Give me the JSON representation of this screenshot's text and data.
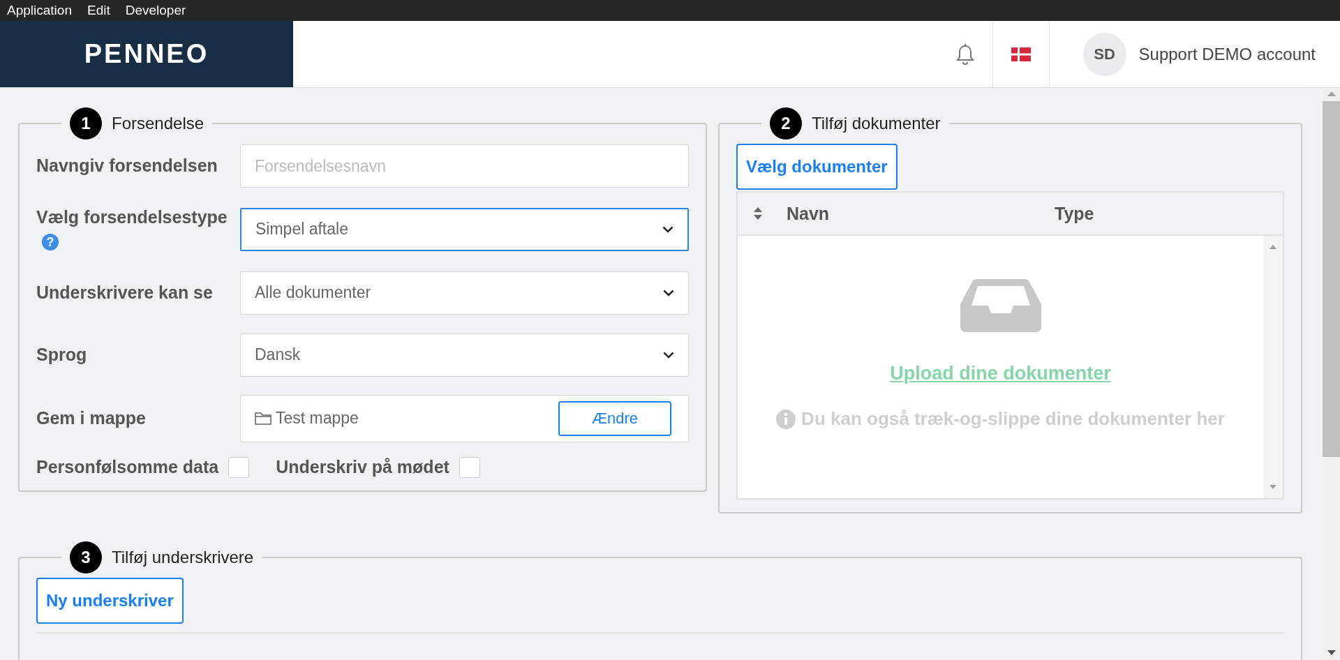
{
  "menu_bar": [
    {
      "label": "Application"
    },
    {
      "label": "Edit"
    },
    {
      "label": "Developer"
    }
  ],
  "header": {
    "logo": "PENNEO",
    "avatar_initials": "SD",
    "user_name": "Support DEMO account"
  },
  "section_1": {
    "number": "1",
    "title": "Forsendelse",
    "fields": [
      {
        "kind": "text",
        "label": "Navngiv forsendelsen",
        "placeholder": "Forsendelsesnavn",
        "focused": false
      },
      {
        "kind": "select",
        "label": "Vælg forsendelsestype",
        "help": "?",
        "value": "Simpel aftale",
        "focused": true
      },
      {
        "kind": "select",
        "label": "Underskrivere kan se",
        "value": "Alle dokumenter",
        "focused": false
      },
      {
        "kind": "select",
        "label": "Sprog",
        "value": "Dansk",
        "focused": false
      },
      {
        "kind": "folder",
        "label": "Gem i mappe",
        "value": "Test mappe",
        "button": "Ændre",
        "focused": false
      }
    ],
    "checkboxes": [
      {
        "label": "Personfølsomme data",
        "checked": false
      },
      {
        "label": "Underskriv på mødet",
        "checked": false
      }
    ]
  },
  "section_2": {
    "number": "2",
    "title": "Tilføj dokumenter",
    "button": "Vælg dokumenter",
    "columns": [
      "Navn",
      "Type"
    ],
    "upload_link": "Upload dine dokumenter",
    "hint": "Du kan også træk-og-slippe dine dokumenter her"
  },
  "section_3": {
    "number": "3",
    "title": "Tilføj underskrivere",
    "button": "Ny underskriver"
  }
}
